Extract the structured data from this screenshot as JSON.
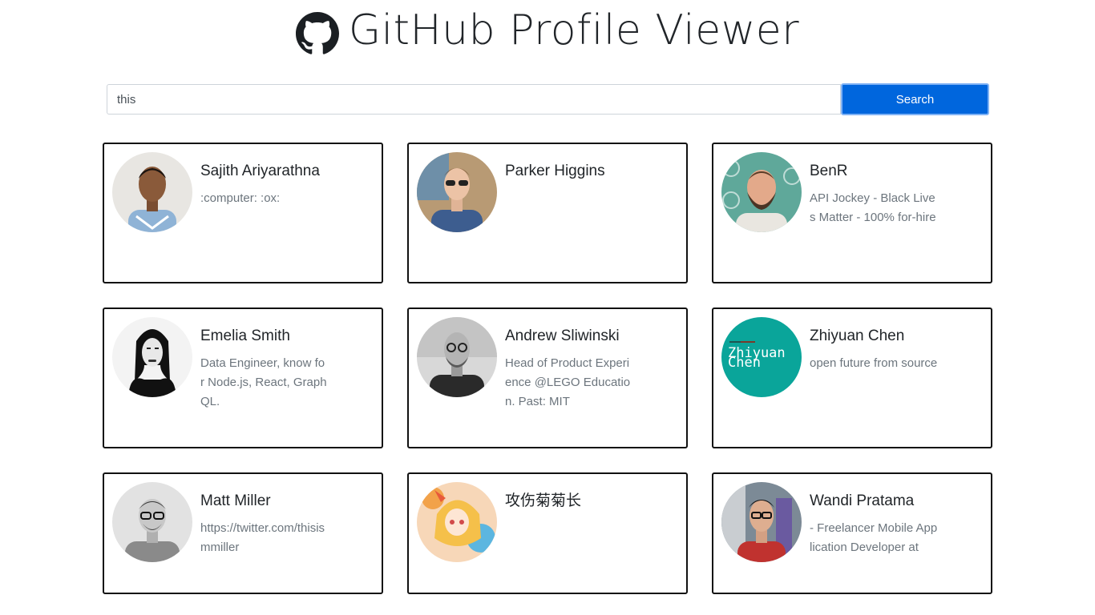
{
  "header": {
    "title": "GitHub Profile Viewer",
    "logo_icon": "github-octocat-icon"
  },
  "search": {
    "value": "this",
    "button_label": "Search"
  },
  "colors": {
    "button": "#0066dd",
    "border": "#111111",
    "bio": "#6c757d"
  },
  "profiles": [
    {
      "name": "Sajith Ariyarathna",
      "bio": ":computer: :ox:",
      "avatar": "portrait-avatar"
    },
    {
      "name": "Parker Higgins",
      "bio": "",
      "avatar": "portrait-avatar"
    },
    {
      "name": "BenR",
      "bio": "API Jockey - Black Lives Matter - 100% for-hire",
      "avatar": "portrait-avatar"
    },
    {
      "name": "Emelia Smith",
      "bio": "Data Engineer, know for Node.js, React, GraphQL.",
      "avatar": "portrait-avatar"
    },
    {
      "name": "Andrew Sliwinski",
      "bio": "Head of Product Experience @LEGO Education. Past: MIT",
      "avatar": "portrait-avatar"
    },
    {
      "name": "Zhiyuan Chen",
      "bio": "open future from source",
      "avatar": "text-logo-avatar",
      "avatar_text_1": "Zhiyuan",
      "avatar_text_2": "Chen"
    },
    {
      "name": "Matt Miller",
      "bio": "https://twitter.com/thisismmiller",
      "avatar": "portrait-avatar"
    },
    {
      "name": "攻伤菊菊长",
      "bio": "",
      "avatar": "anime-avatar"
    },
    {
      "name": "Wandi Pratama",
      "bio": "- Freelancer Mobile Application Developer at",
      "avatar": "portrait-avatar"
    }
  ]
}
